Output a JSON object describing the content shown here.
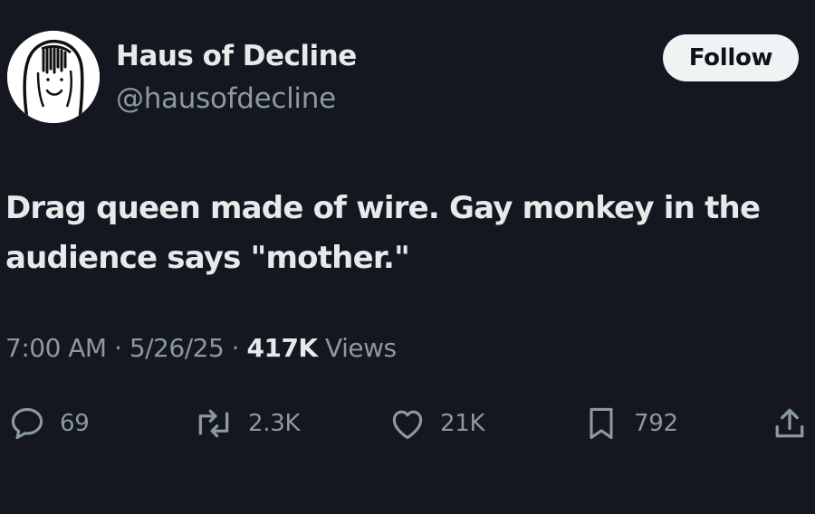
{
  "author": {
    "display_name": "Haus of Decline",
    "handle": "@hausofdecline"
  },
  "follow_label": "Follow",
  "tweet": {
    "text": "Drag queen made of wire. Gay monkey in the audience says \"mother.\""
  },
  "meta": {
    "time": "7:00 AM",
    "separator": "·",
    "date": "5/26/25",
    "views_count": "417K",
    "views_label": "Views"
  },
  "actions": {
    "replies": "69",
    "reposts": "2.3K",
    "likes": "21K",
    "bookmarks": "792"
  },
  "icons": {
    "reply": "reply-icon",
    "repost": "repost-icon",
    "like": "heart-icon",
    "bookmark": "bookmark-icon",
    "share": "share-icon"
  },
  "colors": {
    "background": "#14171f",
    "primary_text": "#e7e9ea",
    "secondary_text": "#8b98a5",
    "follow_button_bg": "#eff3f4",
    "follow_button_text": "#0f1419"
  }
}
